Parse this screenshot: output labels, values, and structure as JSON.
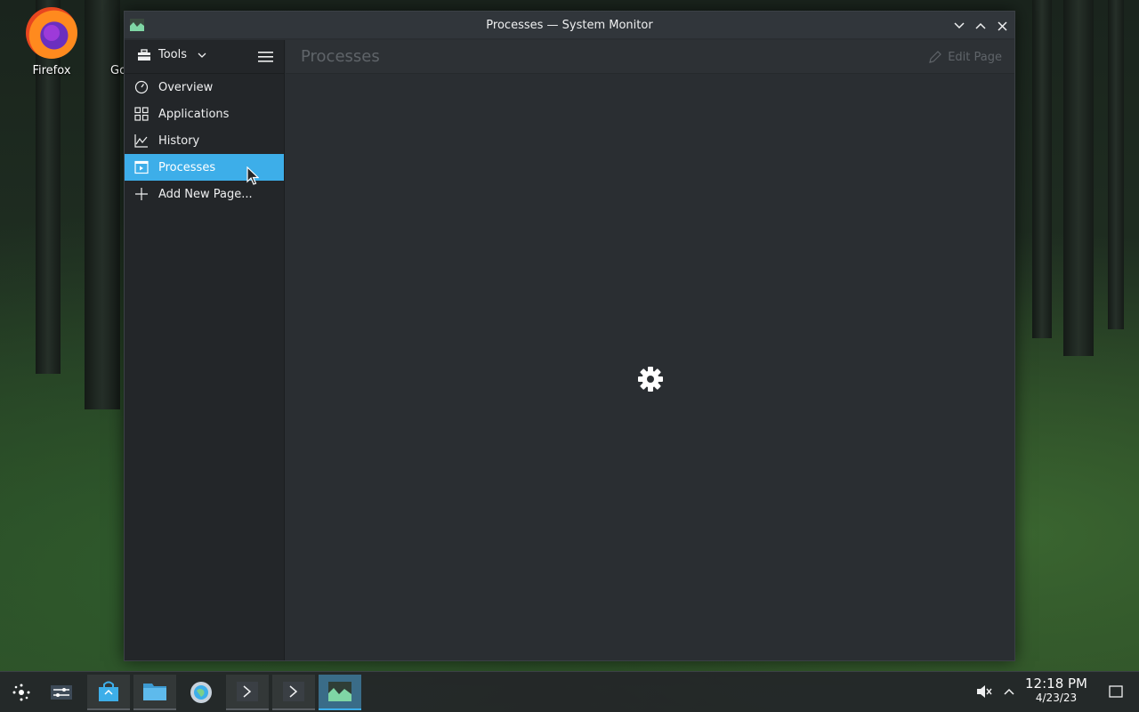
{
  "desktop": {
    "icons": [
      {
        "label": "Firefox"
      },
      {
        "label": "Go"
      }
    ]
  },
  "window": {
    "title": "Processes — System Monitor",
    "toolbar": {
      "tools_label": "Tools",
      "edit_page_label": "Edit Page"
    },
    "sidebar": {
      "items": [
        {
          "label": "Overview",
          "icon": "gauge-icon"
        },
        {
          "label": "Applications",
          "icon": "grid-icon"
        },
        {
          "label": "History",
          "icon": "line-chart-icon"
        },
        {
          "label": "Processes",
          "icon": "process-icon",
          "selected": true
        },
        {
          "label": "Add New Page...",
          "icon": "plus-icon"
        }
      ]
    },
    "page_title": "Processes",
    "status": "loading"
  },
  "taskbar": {
    "clock": {
      "time": "12:18 PM",
      "date": "4/23/23"
    }
  },
  "colors": {
    "accent": "#3daee9",
    "window_bg": "#2a2e32",
    "sidebar_bg": "#232629"
  }
}
